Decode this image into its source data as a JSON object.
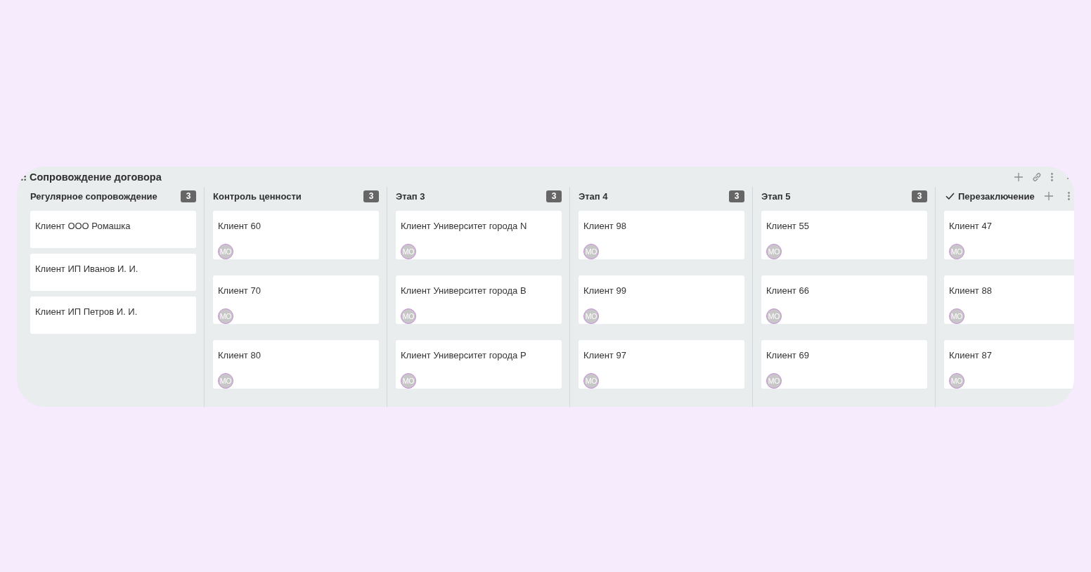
{
  "board": {
    "title": "Сопровождение договора"
  },
  "columns": [
    {
      "kind": "stage",
      "title": "Регулярное сопровождение",
      "count": "3",
      "cards": [
        {
          "title": "Клиент ООО Ромашка"
        },
        {
          "title": "Клиент ИП Иванов И. И."
        },
        {
          "title": "Клиент ИП Петров И. И."
        }
      ]
    },
    {
      "kind": "stage",
      "title": "Контроль ценности",
      "count": "3",
      "cards": [
        {
          "title": "Клиент 60",
          "avatar": "МО"
        },
        {
          "title": "Клиент 70",
          "avatar": "МО"
        },
        {
          "title": "Клиент 80",
          "avatar": "МО"
        }
      ]
    },
    {
      "kind": "stage",
      "title": "Этап 3",
      "count": "3",
      "cards": [
        {
          "title": "Клиент Университет города N",
          "avatar": "МО"
        },
        {
          "title": "Клиент Университет города B",
          "avatar": "МО"
        },
        {
          "title": "Клиент Университет города P",
          "avatar": "МО"
        }
      ]
    },
    {
      "kind": "stage",
      "title": "Этап 4",
      "count": "3",
      "cards": [
        {
          "title": "Клиент 98",
          "avatar": "МО"
        },
        {
          "title": "Клиент 99",
          "avatar": "МО"
        },
        {
          "title": "Клиент 97",
          "avatar": "МО"
        }
      ]
    },
    {
      "kind": "stage",
      "title": "Этап 5",
      "count": "3",
      "cards": [
        {
          "title": "Клиент 55",
          "avatar": "МО"
        },
        {
          "title": "Клиент 66",
          "avatar": "МО"
        },
        {
          "title": "Клиент 69",
          "avatar": "МО"
        }
      ]
    },
    {
      "kind": "final",
      "title": "Перезаключение",
      "cards": [
        {
          "title": "Клиент 47",
          "avatar": "МО"
        },
        {
          "title": "Клиент 88",
          "avatar": "МО"
        },
        {
          "title": "Клиент 87",
          "avatar": "МО"
        }
      ]
    }
  ]
}
